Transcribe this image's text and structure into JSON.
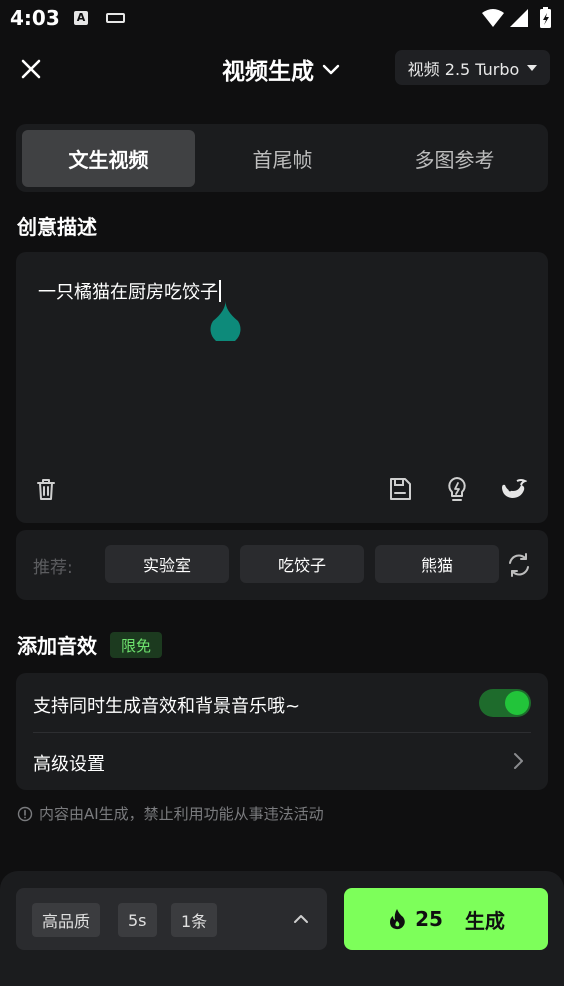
{
  "status_bar": {
    "time": "4:03",
    "a_icon": "A"
  },
  "header": {
    "title": "视频生成",
    "model_label": "视频 2.5 Turbo"
  },
  "tabs": [
    {
      "label": "文生视频",
      "active": true
    },
    {
      "label": "首尾帧",
      "active": false
    },
    {
      "label": "多图参考",
      "active": false
    }
  ],
  "prompt": {
    "section_title": "创意描述",
    "value": "一只橘猫在厨房吃饺子"
  },
  "recommend": {
    "label": "推荐:",
    "chips": [
      "实验室",
      "吃饺子",
      "熊猫"
    ]
  },
  "sound": {
    "title": "添加音效",
    "badge": "限免",
    "toggle_label": "支持同时生成音效和背景音乐哦~",
    "toggle_on": true,
    "advanced_label": "高级设置"
  },
  "disclaimer": "内容由AI生成，禁止利用功能从事违法活动",
  "bottom": {
    "quality": "高品质",
    "duration": "5s",
    "count": "1条",
    "cost": "25",
    "generate_label": "生成"
  },
  "colors": {
    "accent": "#7dff5a",
    "toggle": "#22c43a",
    "badge_text": "#6ee36e",
    "teal_handle": "#0d8a7a"
  }
}
